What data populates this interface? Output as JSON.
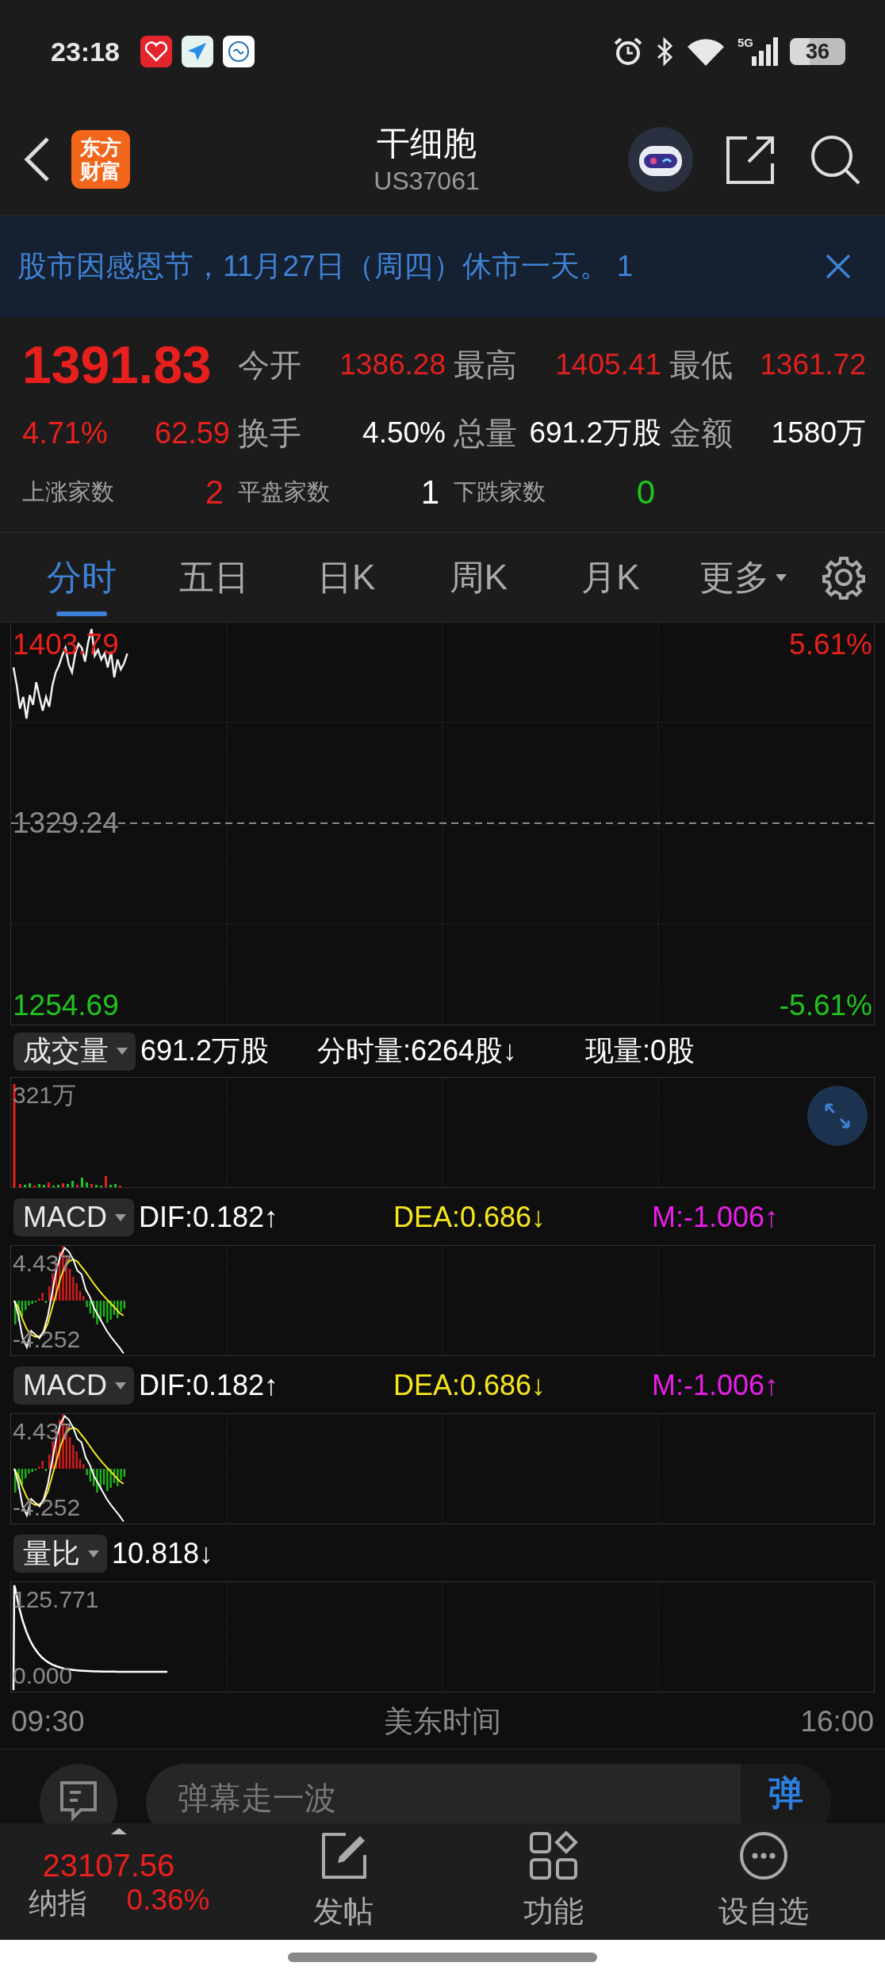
{
  "status_bar": {
    "time": "23:18",
    "network": "5G",
    "battery": "36"
  },
  "header": {
    "logo": [
      "东方",
      "财富"
    ],
    "title": "干细胞",
    "code": "US37061"
  },
  "notice": {
    "text": "股市因感恩节，11月27日（周四）休市一天。 1"
  },
  "quote": {
    "price": "1391.83",
    "change_pct": "4.71%",
    "change": "62.59",
    "stats": [
      {
        "label": "今开",
        "value": "1386.28",
        "color": "#e02020"
      },
      {
        "label": "最高",
        "value": "1405.41",
        "color": "#e02020"
      },
      {
        "label": "最低",
        "value": "1361.72",
        "color": "#e02020"
      },
      {
        "label": "换手",
        "value": "4.50%",
        "color": "#ffffff"
      },
      {
        "label": "总量",
        "value": "691.2万股",
        "color": "#ffffff"
      },
      {
        "label": "金额",
        "value": "1580万",
        "color": "#ffffff"
      }
    ],
    "breadth": [
      {
        "label": "上涨家数",
        "value": "2",
        "color": "#e02020"
      },
      {
        "label": "平盘家数",
        "value": "1",
        "color": "#ffffff"
      },
      {
        "label": "下跌家数",
        "value": "0",
        "color": "#1fc41f"
      }
    ]
  },
  "tabs": [
    {
      "label": "分时",
      "selected": true,
      "kind": "tab"
    },
    {
      "label": "五日",
      "selected": false,
      "kind": "tab"
    },
    {
      "label": "日K",
      "selected": false,
      "kind": "tab"
    },
    {
      "label": "周K",
      "selected": false,
      "kind": "tab"
    },
    {
      "label": "月K",
      "selected": false,
      "kind": "tab"
    },
    {
      "label": "更多",
      "selected": false,
      "kind": "menu"
    }
  ],
  "price_chart": {
    "top_price": "1403.79",
    "base_price": "1329.24",
    "bottom_price": "1254.69",
    "top_pct": "5.61%",
    "bottom_pct": "-5.61%"
  },
  "indicators": [
    {
      "kind": "volume",
      "selector": "成交量",
      "readings": [
        {
          "text": "691.2万股",
          "color": "#ffffff"
        },
        {
          "text": "分时量:6264股↓",
          "color": "#ffffff"
        },
        {
          "text": "现量:0股",
          "color": "#ffffff"
        }
      ],
      "scale": [
        "321万"
      ]
    },
    {
      "kind": "macd",
      "selector": "MACD",
      "readings": [
        {
          "text": "DIF:0.182↑",
          "color": "#ffffff"
        },
        {
          "text": "DEA:0.686↓",
          "color": "#f5e61e"
        },
        {
          "text": "M:-1.006↑",
          "color": "#e81ee8"
        }
      ],
      "scale": [
        "4.437",
        "-4.252"
      ]
    },
    {
      "kind": "macd",
      "selector": "MACD",
      "readings": [
        {
          "text": "DIF:0.182↑",
          "color": "#ffffff"
        },
        {
          "text": "DEA:0.686↓",
          "color": "#f5e61e"
        },
        {
          "text": "M:-1.006↑",
          "color": "#e81ee8"
        }
      ],
      "scale": [
        "4.437",
        "-4.252"
      ]
    },
    {
      "kind": "ratio",
      "selector": "量比",
      "readings": [
        {
          "text": "10.818↓",
          "color": "#ffffff"
        }
      ],
      "scale": [
        "125.771",
        "0.000"
      ]
    }
  ],
  "time_axis": {
    "start": "09:30",
    "zone": "美东时间",
    "end": "16:00"
  },
  "comment": {
    "placeholder": "弹幕走一波",
    "send": "弹"
  },
  "bottom_nav": {
    "index": {
      "value": "23107.56",
      "name": "纳指",
      "change": "0.36%"
    },
    "items": [
      {
        "kind": "post",
        "label": "发帖"
      },
      {
        "kind": "apps",
        "label": "功能"
      },
      {
        "kind": "more",
        "label": "设自选"
      }
    ]
  }
}
